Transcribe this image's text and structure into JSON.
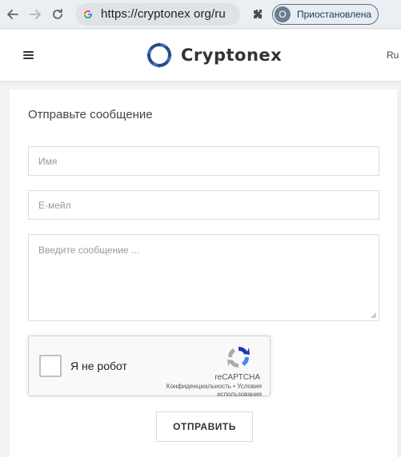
{
  "browser": {
    "url": "https://cryptonex org/ru",
    "profile_initial": "O",
    "profile_status": "Приостановлена"
  },
  "header": {
    "brand": "Cryptonex",
    "language": "Ru"
  },
  "form": {
    "title": "Отправьте сообщение",
    "name_placeholder": "Имя",
    "email_placeholder": "E-мейл",
    "message_placeholder": "Введите сообщение ...",
    "submit_label": "ОТПРАВИТЬ"
  },
  "recaptcha": {
    "label": "Я не робот",
    "brand": "reCAPTCHA",
    "links": "Конфиденциальность • Условия использования"
  },
  "colors": {
    "logo_blue": "#2b4a8a",
    "logo_ring": "#3b6fc4"
  }
}
